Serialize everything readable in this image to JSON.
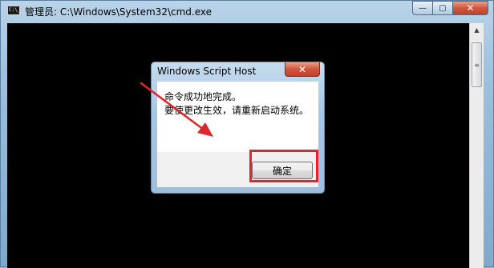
{
  "window": {
    "title": "管理员: C:\\Windows\\System32\\cmd.exe",
    "icon_text": "C:\\_",
    "icon": "console-icon",
    "caption": {
      "minimize": "—",
      "maximize": "▢",
      "close": "✕"
    }
  },
  "console": {
    "scroll_up_glyph": "▲",
    "scroll_thumb_glyph": "≡"
  },
  "dialog": {
    "title": "Windows Script Host",
    "close_glyph": "✕",
    "message_line1": "命令成功地完成。",
    "message_line2": "要使更改生效，请重新启动系统。",
    "ok_label": "确定"
  },
  "annotations": {
    "highlight_color": "#e0262a",
    "arrow_color": "#e0262a"
  }
}
